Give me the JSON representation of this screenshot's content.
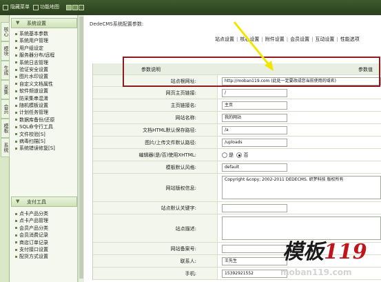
{
  "topbar": {
    "hide_menu": "隐藏菜单",
    "function_map": "功能地图"
  },
  "left_tabs": [
    "核心",
    "模块",
    "生成",
    "采集",
    "会员",
    "模板",
    "系统"
  ],
  "menu": {
    "section1_title": "系统设置",
    "section1_items": [
      "系统基本参数",
      "系统用户管理",
      "用户组设定",
      "服务器分布/远程",
      "系统日志管理",
      "验证安全设置",
      "图片水印设置",
      "自定义文档属性",
      "软件频道设置",
      "防采集串混淆",
      "随机模板设置",
      "计划任务管理",
      "数据库备份/还原",
      "SQL命令行工具",
      "文件校验[S]",
      "病毒扫描[S]",
      "系统错误修复[S]"
    ],
    "section2_title": "支付工具",
    "section2_items": [
      "点卡产品分类",
      "点卡产品管理",
      "会员产品分类",
      "会员消费记录",
      "商店订单记录",
      "支付接口设置",
      "配货方式设置"
    ]
  },
  "main": {
    "heading": "DedeCMS系统配置参数:",
    "tabs": [
      "站点设置",
      "核心设置",
      "附件设置",
      "会员设置",
      "互动设置",
      "性能选项"
    ],
    "col_label": "参数说明",
    "col_value": "参数值",
    "rows": [
      {
        "label": "站点根网址:",
        "value": "http://moban119.com     (此处一定要改成您当前使用的域名)"
      },
      {
        "label": "网页主页链接:",
        "value": "/"
      },
      {
        "label": "主页链接名:",
        "value": "主页"
      },
      {
        "label": "网站名称:",
        "value": "我的网站"
      },
      {
        "label": "文档HTML默认保存路径:",
        "value": "/a"
      },
      {
        "label": "图片/上传文件默认路径:",
        "value": "/uploads"
      },
      {
        "label": "编辑器(是/否)使用XHTML:",
        "value": "",
        "radio_yes": "是",
        "radio_no": "否"
      },
      {
        "label": "模板默认风格:",
        "value": "default"
      },
      {
        "label": "网站版权信息:",
        "value": "Copyright &copy; 2002-2011 DEDECMS. 织梦科技 版权所有"
      },
      {
        "label": "站点默认关键字:",
        "value": ""
      },
      {
        "label": "站点描述:",
        "value": ""
      },
      {
        "label": "网站备案号:",
        "value": ""
      },
      {
        "label": "联系人:",
        "value": "王先生"
      },
      {
        "label": "手机:",
        "value": "15392921552"
      }
    ]
  },
  "watermark": {
    "cn": "模板",
    "num": "119",
    "url": "moban119.com"
  },
  "colors": {
    "menu_green": "#3f5a2e",
    "highlight_red": "#8b1a1a",
    "arrow_yellow": "#f2e600",
    "watermark_red": "#c0151a"
  }
}
